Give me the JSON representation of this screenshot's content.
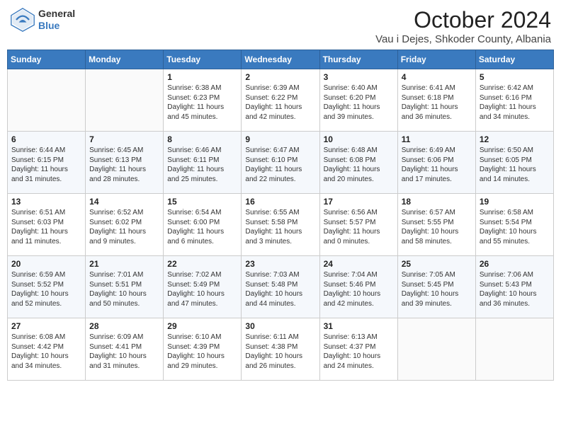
{
  "header": {
    "logo_general": "General",
    "logo_blue": "Blue",
    "month_title": "October 2024",
    "location": "Vau i Dejes, Shkoder County, Albania"
  },
  "days_of_week": [
    "Sunday",
    "Monday",
    "Tuesday",
    "Wednesday",
    "Thursday",
    "Friday",
    "Saturday"
  ],
  "weeks": [
    [
      {
        "day": "",
        "info": ""
      },
      {
        "day": "",
        "info": ""
      },
      {
        "day": "1",
        "info": "Sunrise: 6:38 AM\nSunset: 6:23 PM\nDaylight: 11 hours and 45 minutes."
      },
      {
        "day": "2",
        "info": "Sunrise: 6:39 AM\nSunset: 6:22 PM\nDaylight: 11 hours and 42 minutes."
      },
      {
        "day": "3",
        "info": "Sunrise: 6:40 AM\nSunset: 6:20 PM\nDaylight: 11 hours and 39 minutes."
      },
      {
        "day": "4",
        "info": "Sunrise: 6:41 AM\nSunset: 6:18 PM\nDaylight: 11 hours and 36 minutes."
      },
      {
        "day": "5",
        "info": "Sunrise: 6:42 AM\nSunset: 6:16 PM\nDaylight: 11 hours and 34 minutes."
      }
    ],
    [
      {
        "day": "6",
        "info": "Sunrise: 6:44 AM\nSunset: 6:15 PM\nDaylight: 11 hours and 31 minutes."
      },
      {
        "day": "7",
        "info": "Sunrise: 6:45 AM\nSunset: 6:13 PM\nDaylight: 11 hours and 28 minutes."
      },
      {
        "day": "8",
        "info": "Sunrise: 6:46 AM\nSunset: 6:11 PM\nDaylight: 11 hours and 25 minutes."
      },
      {
        "day": "9",
        "info": "Sunrise: 6:47 AM\nSunset: 6:10 PM\nDaylight: 11 hours and 22 minutes."
      },
      {
        "day": "10",
        "info": "Sunrise: 6:48 AM\nSunset: 6:08 PM\nDaylight: 11 hours and 20 minutes."
      },
      {
        "day": "11",
        "info": "Sunrise: 6:49 AM\nSunset: 6:06 PM\nDaylight: 11 hours and 17 minutes."
      },
      {
        "day": "12",
        "info": "Sunrise: 6:50 AM\nSunset: 6:05 PM\nDaylight: 11 hours and 14 minutes."
      }
    ],
    [
      {
        "day": "13",
        "info": "Sunrise: 6:51 AM\nSunset: 6:03 PM\nDaylight: 11 hours and 11 minutes."
      },
      {
        "day": "14",
        "info": "Sunrise: 6:52 AM\nSunset: 6:02 PM\nDaylight: 11 hours and 9 minutes."
      },
      {
        "day": "15",
        "info": "Sunrise: 6:54 AM\nSunset: 6:00 PM\nDaylight: 11 hours and 6 minutes."
      },
      {
        "day": "16",
        "info": "Sunrise: 6:55 AM\nSunset: 5:58 PM\nDaylight: 11 hours and 3 minutes."
      },
      {
        "day": "17",
        "info": "Sunrise: 6:56 AM\nSunset: 5:57 PM\nDaylight: 11 hours and 0 minutes."
      },
      {
        "day": "18",
        "info": "Sunrise: 6:57 AM\nSunset: 5:55 PM\nDaylight: 10 hours and 58 minutes."
      },
      {
        "day": "19",
        "info": "Sunrise: 6:58 AM\nSunset: 5:54 PM\nDaylight: 10 hours and 55 minutes."
      }
    ],
    [
      {
        "day": "20",
        "info": "Sunrise: 6:59 AM\nSunset: 5:52 PM\nDaylight: 10 hours and 52 minutes."
      },
      {
        "day": "21",
        "info": "Sunrise: 7:01 AM\nSunset: 5:51 PM\nDaylight: 10 hours and 50 minutes."
      },
      {
        "day": "22",
        "info": "Sunrise: 7:02 AM\nSunset: 5:49 PM\nDaylight: 10 hours and 47 minutes."
      },
      {
        "day": "23",
        "info": "Sunrise: 7:03 AM\nSunset: 5:48 PM\nDaylight: 10 hours and 44 minutes."
      },
      {
        "day": "24",
        "info": "Sunrise: 7:04 AM\nSunset: 5:46 PM\nDaylight: 10 hours and 42 minutes."
      },
      {
        "day": "25",
        "info": "Sunrise: 7:05 AM\nSunset: 5:45 PM\nDaylight: 10 hours and 39 minutes."
      },
      {
        "day": "26",
        "info": "Sunrise: 7:06 AM\nSunset: 5:43 PM\nDaylight: 10 hours and 36 minutes."
      }
    ],
    [
      {
        "day": "27",
        "info": "Sunrise: 6:08 AM\nSunset: 4:42 PM\nDaylight: 10 hours and 34 minutes."
      },
      {
        "day": "28",
        "info": "Sunrise: 6:09 AM\nSunset: 4:41 PM\nDaylight: 10 hours and 31 minutes."
      },
      {
        "day": "29",
        "info": "Sunrise: 6:10 AM\nSunset: 4:39 PM\nDaylight: 10 hours and 29 minutes."
      },
      {
        "day": "30",
        "info": "Sunrise: 6:11 AM\nSunset: 4:38 PM\nDaylight: 10 hours and 26 minutes."
      },
      {
        "day": "31",
        "info": "Sunrise: 6:13 AM\nSunset: 4:37 PM\nDaylight: 10 hours and 24 minutes."
      },
      {
        "day": "",
        "info": ""
      },
      {
        "day": "",
        "info": ""
      }
    ]
  ]
}
